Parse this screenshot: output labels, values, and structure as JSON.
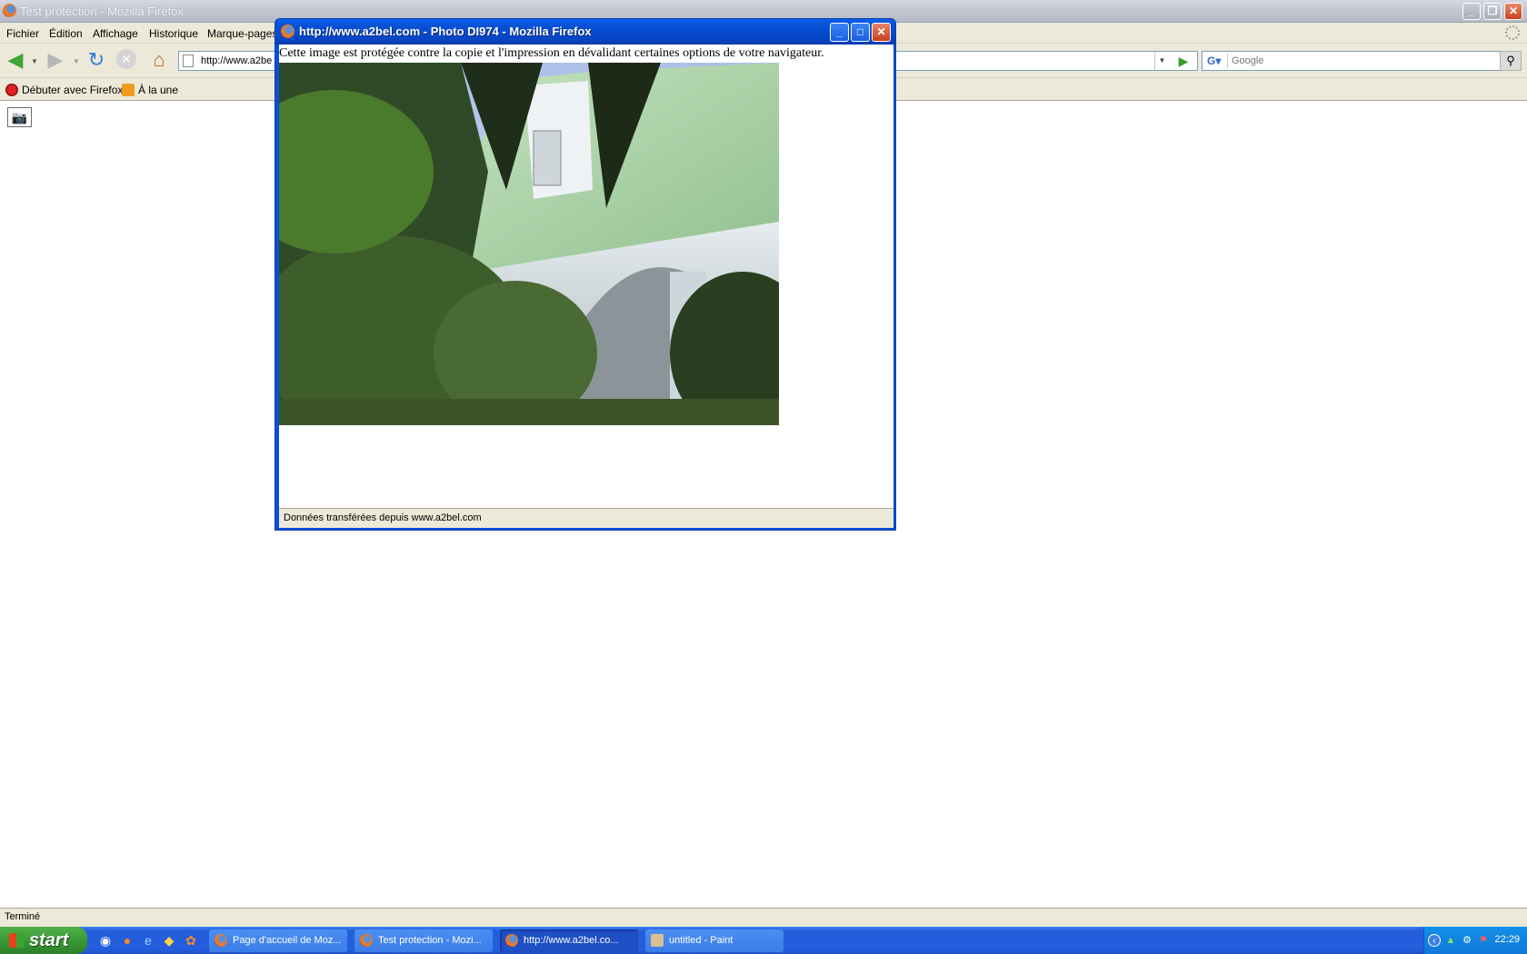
{
  "window": {
    "title": "Test protection - Mozilla Firefox"
  },
  "menu": [
    "Fichier",
    "Édition",
    "Affichage",
    "Historique",
    "Marque-pages"
  ],
  "urlbar": {
    "value": "http://www.a2be"
  },
  "search": {
    "placeholder": "Google"
  },
  "bookmarks": [
    "Débuter avec Firefox",
    "À la une"
  ],
  "statusbar": {
    "text": "Terminé"
  },
  "popup": {
    "title": "http://www.a2bel.com - Photo DI974 - Mozilla Firefox",
    "message": "Cette image est protégée contre la copie et l'impression en dévalidant certaines options de votre navigateur.",
    "status": "Données transférées depuis www.a2bel.com"
  },
  "taskbar": {
    "start_label": "start",
    "tasks": [
      "Page d'accueil de Moz...",
      "Test protection - Mozi...",
      "http://www.a2bel.co...",
      "untitled - Paint"
    ],
    "active_task": 2,
    "clock": "22:29"
  },
  "colors": {
    "xp_blue": "#245edc",
    "start_green": "#3b9a36",
    "chrome_bg": "#ece9d8"
  }
}
